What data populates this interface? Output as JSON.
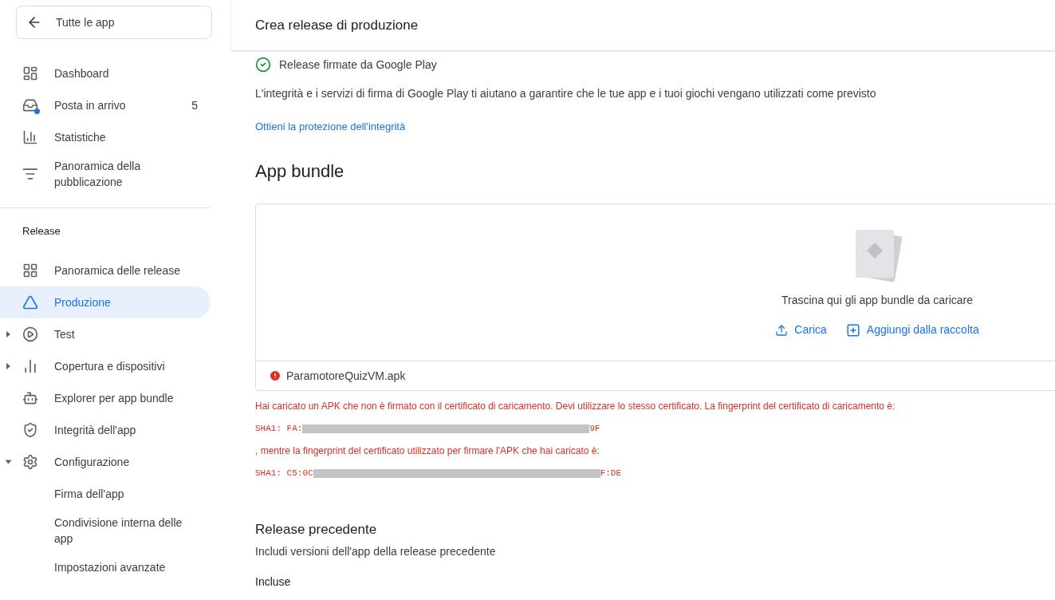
{
  "sidebar": {
    "back_button": {
      "label": "Tutte le app"
    },
    "top_items": [
      {
        "label": "Dashboard",
        "selected": false
      },
      {
        "label": "Posta in arrivo",
        "selected": false,
        "count": "5",
        "unread": true
      },
      {
        "label": "Statistiche",
        "selected": false
      },
      {
        "label": "Panoramica della pubblicazione",
        "selected": false
      }
    ],
    "section_title": "Release",
    "release_items": [
      {
        "label": "Panoramica delle release",
        "selected": false
      },
      {
        "label": "Produzione",
        "selected": true
      },
      {
        "label": "Test",
        "selected": false,
        "expanded": false
      },
      {
        "label": "Copertura e dispositivi",
        "selected": false,
        "expanded": false
      },
      {
        "label": "Explorer per app bundle",
        "selected": false
      },
      {
        "label": "Integrità dell'app",
        "selected": false
      },
      {
        "label": "Configurazione",
        "selected": false,
        "expanded": true,
        "children": [
          {
            "label": "Firma dell'app",
            "selected": false
          },
          {
            "label": "Condivisione interna delle app",
            "selected": false
          },
          {
            "label": "Impostazioni avanzate",
            "selected": false
          }
        ]
      }
    ]
  },
  "page_title": "Crea release di produzione",
  "signing": {
    "status": "Release firmate da Google Play",
    "description": "L'integrità e i servizi di firma di Google Play ti aiutano a garantire che le tue app e i tuoi giochi vengano utilizzati come previsto",
    "link": "Ottieni la protezione dell'integrità"
  },
  "app_bundle": {
    "title": "App bundle",
    "drop_hint": "Trascina qui gli app bundle da caricare",
    "actions": [
      "Carica",
      "Aggiungi dalla raccolta"
    ],
    "file": {
      "name": "ParamotoreQuizVM.apk",
      "error": true
    },
    "errors": [
      {
        "kind": "text",
        "text": "Hai caricato un APK che non è firmato con il certificato di caricamento. Devi utilizzare lo stesso certificato. La fingerprint del certificato di caricamento è:"
      },
      {
        "kind": "fingerprint",
        "prefix": "SHA1: FA:",
        "suffix": "9F"
      },
      {
        "kind": "text",
        "text": ", mentre la fingerprint del certificato utilizzato per firmare l'APK che hai caricato è:"
      },
      {
        "kind": "fingerprint",
        "prefix": "SHA1: C5:0C",
        "suffix": "F:DE"
      }
    ]
  },
  "previous_release": {
    "title": "Release precedente",
    "description": "Includi versioni dell'app della release precedente",
    "subtitle": "Incluse"
  }
}
